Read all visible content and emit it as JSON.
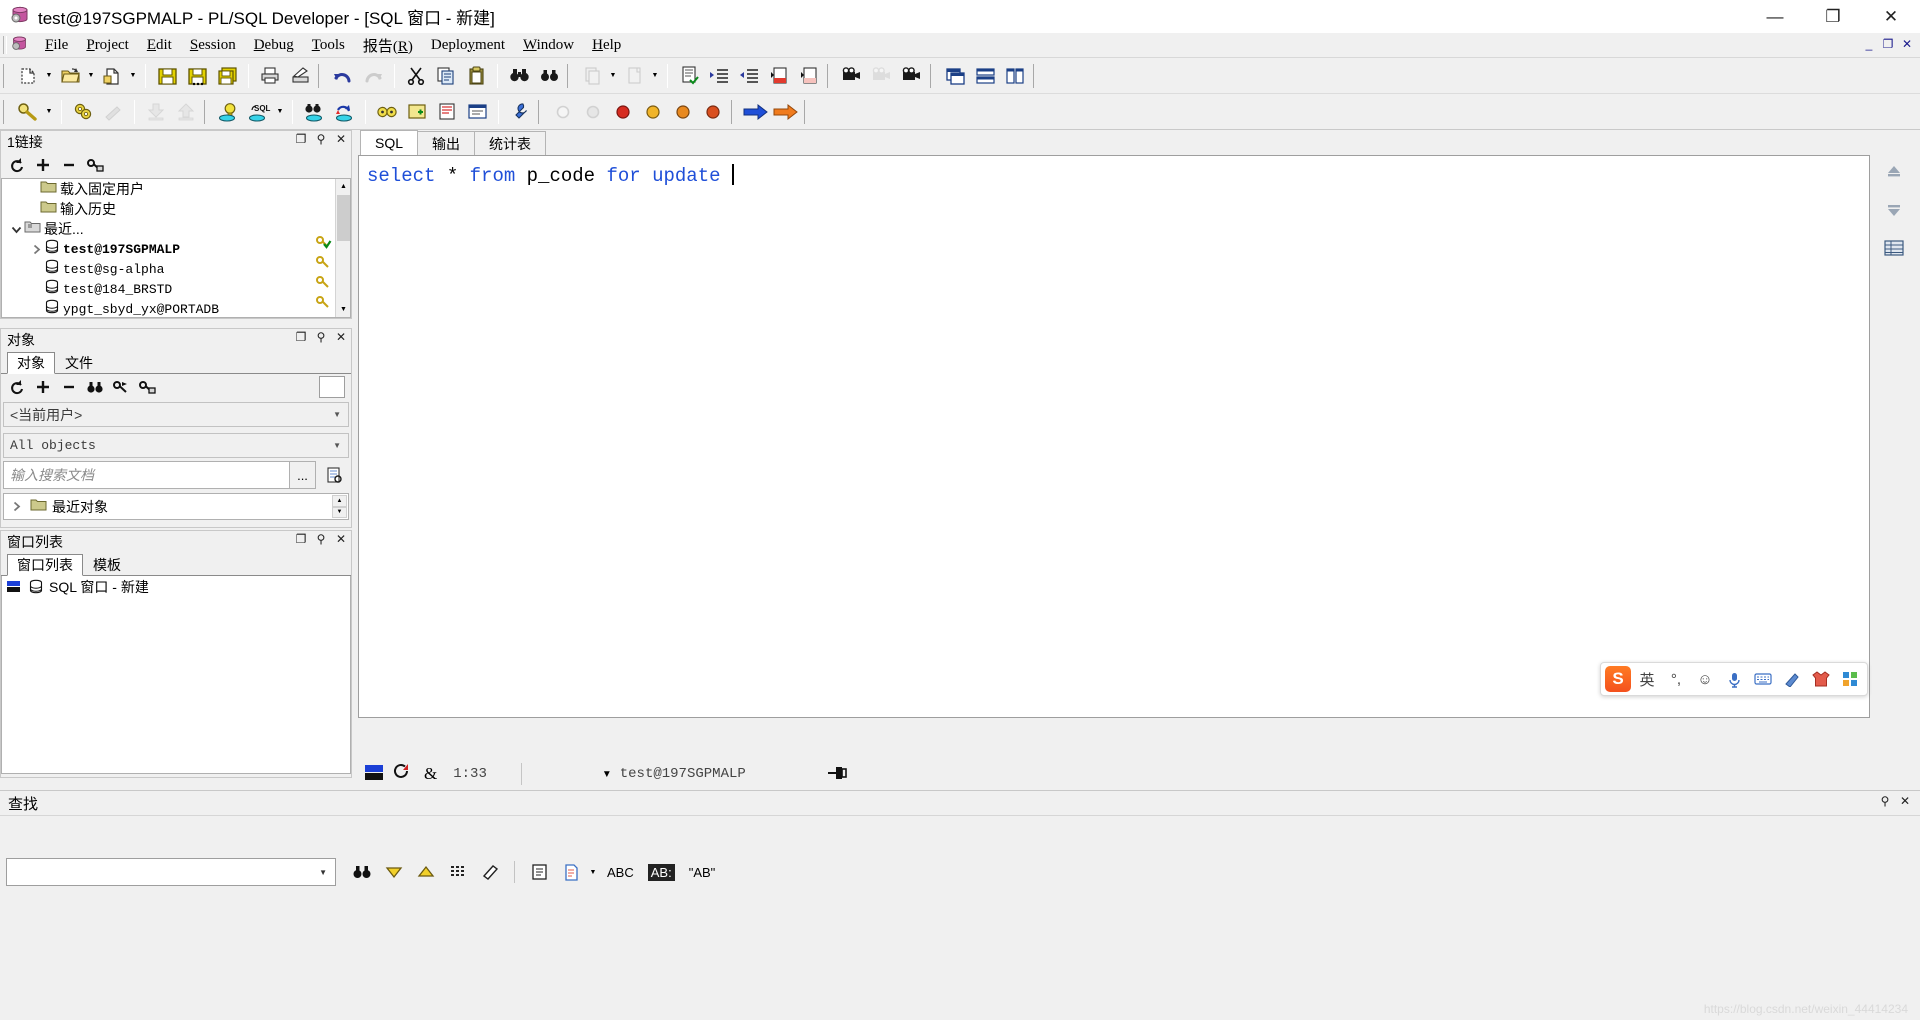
{
  "window": {
    "title": "test@197SGPMALP - PL/SQL Developer - [SQL 窗口 - 新建]",
    "icon": "database-icon",
    "minimize_label": "—",
    "restore_label": "❐",
    "close_label": "✕"
  },
  "menubar": {
    "icon": "app-database-icon",
    "items": [
      {
        "label": "File",
        "accel": "F"
      },
      {
        "label": "Project",
        "accel": "P"
      },
      {
        "label": "Edit",
        "accel": "E"
      },
      {
        "label": "Session",
        "accel": "S"
      },
      {
        "label": "Debug",
        "accel": "D"
      },
      {
        "label": "Tools",
        "accel": "T"
      },
      {
        "label": "报告(R)",
        "accel": "R"
      },
      {
        "label": "Deployment",
        "accel": "y"
      },
      {
        "label": "Window",
        "accel": "W"
      },
      {
        "label": "Help",
        "accel": "H"
      }
    ],
    "mdi_buttons": [
      {
        "name": "mdi-minimize",
        "label": "_"
      },
      {
        "name": "mdi-restore",
        "label": "❐"
      },
      {
        "name": "mdi-close",
        "label": "✕"
      }
    ]
  },
  "toolbar_row1": [
    {
      "name": "new-button",
      "icon": "new-document-icon",
      "dropdown": true
    },
    {
      "name": "open-button",
      "icon": "open-folder-icon",
      "dropdown": true
    },
    {
      "name": "reopen-button",
      "icon": "reopen-document-icon",
      "dropdown": true
    },
    {
      "name": "save-button",
      "icon": "save-disk-icon"
    },
    {
      "name": "save-as-button",
      "icon": "save-as-disk-icon"
    },
    {
      "name": "save-all-button",
      "icon": "save-all-disks-icon"
    },
    {
      "name": "print-button",
      "icon": "printer-icon"
    },
    {
      "name": "print-setup-button",
      "icon": "print-setup-icon"
    },
    {
      "name": "undo-button",
      "icon": "undo-arrow-icon"
    },
    {
      "name": "redo-button",
      "icon": "redo-arrow-icon",
      "disabled": true
    },
    {
      "name": "cut-button",
      "icon": "scissors-icon"
    },
    {
      "name": "copy-button",
      "icon": "copy-pages-icon"
    },
    {
      "name": "paste-button",
      "icon": "clipboard-icon"
    },
    {
      "name": "find-button",
      "icon": "binoculars-icon"
    },
    {
      "name": "find-next-button",
      "icon": "binoculars-next-icon"
    },
    {
      "name": "prev-window-button",
      "icon": "prev-document-icon",
      "disabled": true,
      "dropdown": true
    },
    {
      "name": "next-window-button",
      "icon": "next-document-icon",
      "disabled": true,
      "dropdown": true
    },
    {
      "name": "execute-button",
      "icon": "document-check-icon"
    },
    {
      "name": "indent-button",
      "icon": "indent-increase-icon"
    },
    {
      "name": "outdent-button",
      "icon": "indent-decrease-icon"
    },
    {
      "name": "comment-button",
      "icon": "document-red-icon"
    },
    {
      "name": "uncomment-button",
      "icon": "document-pink-icon"
    },
    {
      "name": "record-macro-button",
      "icon": "camera-icon"
    },
    {
      "name": "stop-macro-button",
      "icon": "camera-stop-icon",
      "disabled": true
    },
    {
      "name": "play-macro-button",
      "icon": "camera-play-icon"
    },
    {
      "name": "cascade-windows-button",
      "icon": "cascade-windows-icon"
    },
    {
      "name": "tile-horizontal-button",
      "icon": "tile-horizontal-icon"
    },
    {
      "name": "tile-vertical-button",
      "icon": "tile-vertical-icon"
    }
  ],
  "toolbar_row2": [
    {
      "name": "explain-plan-button",
      "icon": "magnifier-key-icon",
      "dropdown": true
    },
    {
      "name": "compile-button",
      "icon": "gears-icon"
    },
    {
      "name": "compile-invalid-button",
      "icon": "grey-wrench-icon",
      "disabled": true
    },
    {
      "name": "import-button",
      "icon": "import-arrow-icon",
      "disabled": true
    },
    {
      "name": "export-button",
      "icon": "export-arrow-icon",
      "disabled": true
    },
    {
      "name": "new-sql-window-button",
      "icon": "bulb-database-icon"
    },
    {
      "name": "sql-command-button",
      "icon": "sql-database-icon",
      "dropdown": true
    },
    {
      "name": "find-database-objects-button",
      "icon": "binoculars-database-icon"
    },
    {
      "name": "rollback-button",
      "icon": "rollback-database-icon"
    },
    {
      "name": "session-button",
      "icon": "sessions-icon"
    },
    {
      "name": "test-window-button",
      "icon": "test-window-icon"
    },
    {
      "name": "beautifier-button",
      "icon": "beautifier-icon"
    },
    {
      "name": "object-browser-button",
      "icon": "browser-icon"
    },
    {
      "name": "preferences-button",
      "icon": "wrench-icon"
    },
    {
      "name": "breakpoint-button",
      "icon": "breakpoint-hollow-icon",
      "disabled": true
    },
    {
      "name": "toggle-breakpoint-button",
      "icon": "breakpoint-grey-icon",
      "disabled": true
    },
    {
      "name": "run-debug-button",
      "icon": "run-red-icon"
    },
    {
      "name": "step-over-button",
      "icon": "step-over-icon"
    },
    {
      "name": "step-into-button",
      "icon": "step-into-icon"
    },
    {
      "name": "step-out-button",
      "icon": "step-out-icon"
    },
    {
      "name": "next-page-button",
      "icon": "blue-arrow-right-icon"
    },
    {
      "name": "last-page-button",
      "icon": "orange-arrow-right-icon"
    }
  ],
  "connections_panel": {
    "caption": "1链接",
    "caption_buttons": [
      {
        "name": "float-button",
        "label": "❐"
      },
      {
        "name": "pin-button",
        "label": "⚲"
      },
      {
        "name": "close-button",
        "label": "✕"
      }
    ],
    "toolbar": [
      {
        "name": "refresh-button",
        "icon": "refresh-icon"
      },
      {
        "name": "add-connection-button",
        "icon": "plus-icon"
      },
      {
        "name": "remove-connection-button",
        "icon": "minus-icon"
      },
      {
        "name": "connection-properties-button",
        "icon": "key-window-icon"
      }
    ],
    "tree": [
      {
        "label": "载入固定用户",
        "icon": "folder-icon",
        "indent": 1,
        "expander": "",
        "bold": false,
        "zh": true
      },
      {
        "label": "输入历史",
        "icon": "folder-icon",
        "indent": 1,
        "expander": "",
        "bold": false,
        "zh": true
      },
      {
        "label": "最近...",
        "icon": "folder-grey-icon",
        "indent": 1,
        "expander": "expanded",
        "bold": false,
        "zh": true
      },
      {
        "label": "test@197SGPMALP",
        "icon": "database-icon",
        "indent": 2,
        "expander": "collapsed",
        "bold": true,
        "zh": false
      },
      {
        "label": "test@sg-alpha",
        "icon": "database-icon",
        "indent": 2,
        "expander": "",
        "bold": false,
        "zh": false
      },
      {
        "label": "test@184_BRSTD",
        "icon": "database-icon",
        "indent": 2,
        "expander": "",
        "bold": false,
        "zh": false
      },
      {
        "label": "ypgt_sbyd_yx@PORTADB",
        "icon": "database-icon",
        "indent": 2,
        "expander": "",
        "bold": false,
        "zh": false
      }
    ],
    "status_icons": [
      "key-check-icon",
      "key-icon",
      "key-icon",
      "key-icon"
    ]
  },
  "objects_panel": {
    "caption": "对象",
    "caption_buttons": [
      {
        "name": "float-button",
        "label": "❐"
      },
      {
        "name": "pin-button",
        "label": "⚲"
      },
      {
        "name": "close-button",
        "label": "✕"
      }
    ],
    "tabs": [
      {
        "label": "对象",
        "active": true
      },
      {
        "label": "文件",
        "active": false
      }
    ],
    "toolbar": [
      {
        "name": "refresh-button",
        "icon": "refresh-icon"
      },
      {
        "name": "expand-button",
        "icon": "plus-icon"
      },
      {
        "name": "collapse-button",
        "icon": "minus-icon"
      },
      {
        "name": "find-object-button",
        "icon": "binoculars-icon"
      },
      {
        "name": "filter-button",
        "icon": "key-flag-icon"
      },
      {
        "name": "object-props-button",
        "icon": "key-window-icon"
      }
    ],
    "user_select": "<当前用户>",
    "type_select": "All objects",
    "search_placeholder": "输入搜索文档",
    "search_value": "",
    "browse_button_label": "...",
    "extra_button": "document-search-icon",
    "recent_objects": "最近对象",
    "recent_objects_icon": "folder-icon"
  },
  "window_list_panel": {
    "caption": "窗口列表",
    "caption_buttons": [
      {
        "name": "float-button",
        "label": "❐"
      },
      {
        "name": "pin-button",
        "label": "⚲"
      },
      {
        "name": "close-button",
        "label": "✕"
      }
    ],
    "tabs": [
      {
        "label": "窗口列表",
        "active": true
      },
      {
        "label": "模板",
        "active": false
      }
    ],
    "items": [
      {
        "label": "SQL 窗口 - 新建",
        "icon": "sql-window-icon"
      }
    ]
  },
  "editor": {
    "tabs": [
      {
        "label": "SQL",
        "active": true
      },
      {
        "label": "输出",
        "active": false
      },
      {
        "label": "统计表",
        "active": false
      }
    ],
    "sql_tokens": [
      {
        "text": "select",
        "type": "keyword"
      },
      {
        "text": " ",
        "type": "plain"
      },
      {
        "text": "*",
        "type": "plain"
      },
      {
        "text": " ",
        "type": "plain"
      },
      {
        "text": "from",
        "type": "keyword"
      },
      {
        "text": " p_code ",
        "type": "plain"
      },
      {
        "text": "for",
        "type": "keyword"
      },
      {
        "text": " ",
        "type": "plain"
      },
      {
        "text": "update",
        "type": "keyword"
      },
      {
        "text": " ",
        "type": "plain"
      }
    ],
    "sql_text": "select * from p_code for update ",
    "right_rail": [
      {
        "name": "scroll-up-button",
        "icon": "up-arrow-icon"
      },
      {
        "name": "scroll-down-button",
        "icon": "down-arrow-icon"
      },
      {
        "name": "results-grid-button",
        "icon": "grid-icon"
      }
    ]
  },
  "ime_bar": {
    "logo": "S",
    "items": [
      {
        "name": "ime-language-button",
        "label": "英"
      },
      {
        "name": "ime-punctuation-button",
        "label": "°,"
      },
      {
        "name": "ime-emoji-button",
        "label": "☺"
      },
      {
        "name": "ime-voice-button",
        "label": "🎤"
      },
      {
        "name": "ime-keyboard-button",
        "label": "⌨"
      },
      {
        "name": "ime-handwriting-button",
        "label": "✍"
      },
      {
        "name": "ime-skin-button",
        "label": "👕"
      },
      {
        "name": "ime-menu-button",
        "label": "▦"
      }
    ]
  },
  "statusbar": {
    "mode_icon": "insert-mode-icon",
    "modified_icon": "modified-icon",
    "lock_icon": "ampersand-icon",
    "cursor_position": "1:33",
    "session_dropdown_icon": "chevron-down-icon",
    "session": "test@197SGPMALP",
    "pin_icon": "pin-window-icon"
  },
  "find_panel": {
    "caption": "查找",
    "caption_buttons": [
      {
        "name": "pin-button",
        "label": "⚲"
      },
      {
        "name": "close-button",
        "label": "✕"
      }
    ],
    "search_value": "",
    "toolbar": [
      {
        "name": "find-button",
        "icon": "binoculars-icon"
      },
      {
        "name": "find-next-button",
        "icon": "yellow-down-triangle-icon"
      },
      {
        "name": "find-prev-button",
        "icon": "yellow-up-triangle-icon"
      },
      {
        "name": "find-all-button",
        "icon": "grid-dots-icon"
      },
      {
        "name": "clear-button",
        "icon": "eraser-icon"
      },
      {
        "name": "list-view-button",
        "icon": "list-icon"
      },
      {
        "name": "document-scope-button",
        "icon": "document-lines-icon",
        "dropdown": true
      },
      {
        "name": "match-case-button",
        "label": "ABC"
      },
      {
        "name": "match-highlight-button",
        "label": "AB:"
      },
      {
        "name": "whole-word-button",
        "label": "\"AB\""
      }
    ]
  },
  "watermark": "https://blog.csdn.net/weixin_44414234"
}
